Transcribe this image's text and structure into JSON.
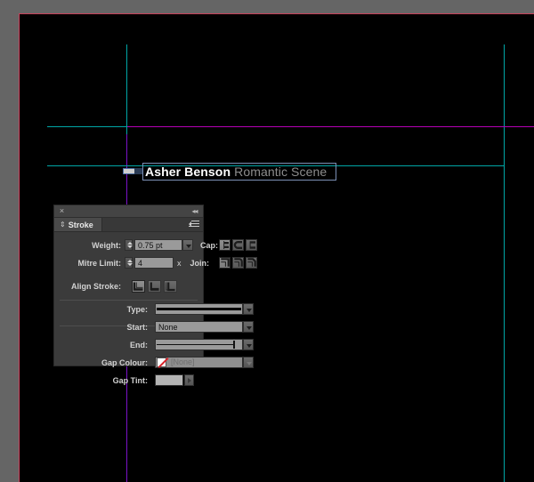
{
  "document": {
    "canvas_background": "#000000",
    "pasteboard_color": "#656565",
    "bleed_color": "#c8415a",
    "text_frame": {
      "primary_text": "Asher Benson",
      "secondary_text": "Romantic Scene",
      "selected": true
    },
    "guides": {
      "teal_color": "#00a6a6",
      "magenta_color": "#b500b5",
      "purple_color": "#7a12c8"
    }
  },
  "stroke_panel": {
    "title": "Stroke",
    "close_label": "×",
    "collapse_label": "«",
    "tab_diamond": "⇕",
    "weight": {
      "label": "Weight:",
      "value": "0.75 pt"
    },
    "cap": {
      "label": "Cap:",
      "options": [
        "butt-cap",
        "round-cap",
        "projecting-cap"
      ],
      "selected": 0
    },
    "mitre_limit": {
      "label": "Mitre Limit:",
      "value": "4",
      "unit": "x"
    },
    "join": {
      "label": "Join:",
      "options": [
        "mitre-join",
        "round-join",
        "bevel-join"
      ],
      "selected": 0
    },
    "align_stroke": {
      "label": "Align Stroke:",
      "options": [
        "align-center",
        "align-inside",
        "align-outside"
      ],
      "selected": 0
    },
    "type": {
      "label": "Type:",
      "value": ""
    },
    "start": {
      "label": "Start:",
      "value": "None"
    },
    "end": {
      "label": "End:",
      "value": ""
    },
    "gap_colour": {
      "label": "Gap Colour:",
      "value": "[None]"
    },
    "gap_tint": {
      "label": "Gap Tint:",
      "value": ""
    }
  }
}
